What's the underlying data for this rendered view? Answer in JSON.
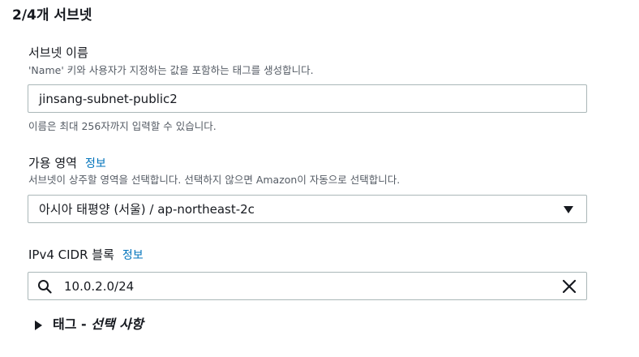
{
  "step_title": "2/4개 서브넷",
  "subnet_name": {
    "label": "서브넷 이름",
    "description": "'Name' 키와 사용자가 지정하는 값을 포함하는 태그를 생성합니다.",
    "value": "jinsang-subnet-public2",
    "hint": "이름은 최대 256자까지 입력할 수 있습니다."
  },
  "availability_zone": {
    "label": "가용 영역",
    "info_link": "정보",
    "description": "서브넷이 상주할 영역을 선택합니다. 선택하지 않으면 Amazon이 자동으로 선택합니다.",
    "selected": "아시아 태평양 (서울) / ap-northeast-2c"
  },
  "ipv4_cidr": {
    "label": "IPv4 CIDR 블록",
    "info_link": "정보",
    "value": "10.0.2.0/24"
  },
  "tags_section": {
    "label": "태그 - ",
    "optional": "선택 사항"
  }
}
